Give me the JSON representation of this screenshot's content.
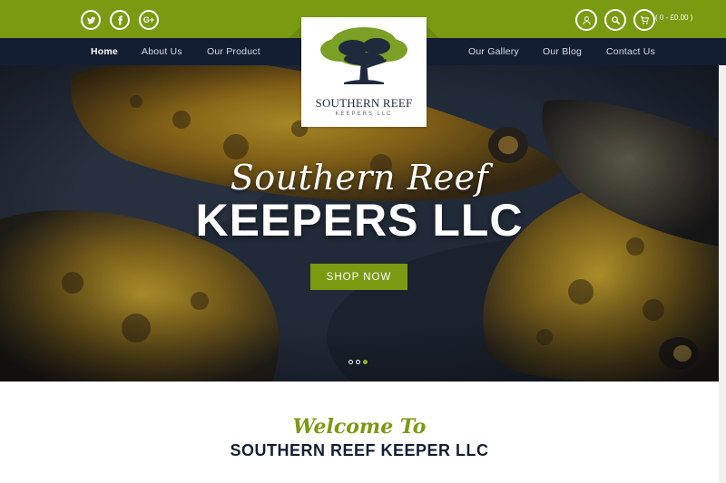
{
  "topbar": {
    "social": [
      {
        "icon": "twitter-icon"
      },
      {
        "icon": "facebook-icon"
      },
      {
        "icon": "google-plus-icon",
        "glyph": "G+"
      }
    ],
    "account_icon": "user-icon",
    "search_icon": "search-icon",
    "cart_icon": "cart-icon",
    "cart_label": "( 0 - £0.00 )"
  },
  "nav": {
    "left": [
      "Home",
      "About Us",
      "Our Product"
    ],
    "right": [
      "Our Gallery",
      "Our Blog",
      "Contact Us"
    ],
    "active": "Home"
  },
  "logo": {
    "name": "SOUTHERN REEF",
    "sub": "KEEPERS LLC"
  },
  "hero": {
    "script": "Southern Reef",
    "title": "KEEPERS LLC",
    "button": "SHOP NOW",
    "slides": 3,
    "active_slide": 3
  },
  "welcome": {
    "script": "Welcome To",
    "title": "SOUTHERN REEF KEEPER LLC"
  },
  "colors": {
    "green": "#7a9a12",
    "navy": "#141e33"
  }
}
